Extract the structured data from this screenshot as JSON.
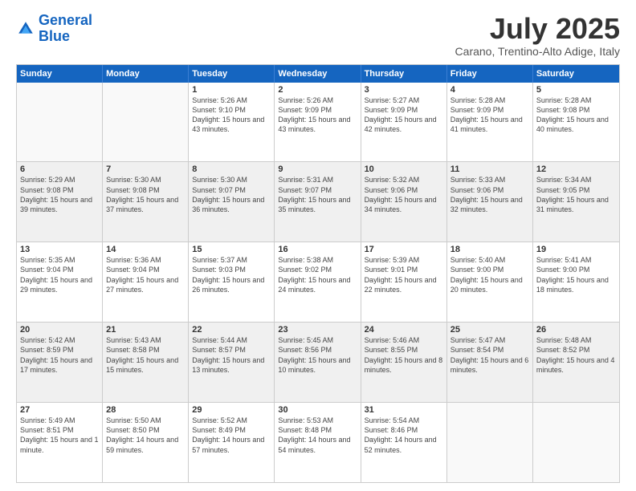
{
  "logo": {
    "line1": "General",
    "line2": "Blue"
  },
  "title": "July 2025",
  "location": "Carano, Trentino-Alto Adige, Italy",
  "days_of_week": [
    "Sunday",
    "Monday",
    "Tuesday",
    "Wednesday",
    "Thursday",
    "Friday",
    "Saturday"
  ],
  "weeks": [
    [
      {
        "day": "",
        "empty": true
      },
      {
        "day": "",
        "empty": true
      },
      {
        "day": "1",
        "sunrise": "5:26 AM",
        "sunset": "9:10 PM",
        "daylight": "15 hours and 43 minutes."
      },
      {
        "day": "2",
        "sunrise": "5:26 AM",
        "sunset": "9:09 PM",
        "daylight": "15 hours and 43 minutes."
      },
      {
        "day": "3",
        "sunrise": "5:27 AM",
        "sunset": "9:09 PM",
        "daylight": "15 hours and 42 minutes."
      },
      {
        "day": "4",
        "sunrise": "5:28 AM",
        "sunset": "9:09 PM",
        "daylight": "15 hours and 41 minutes."
      },
      {
        "day": "5",
        "sunrise": "5:28 AM",
        "sunset": "9:08 PM",
        "daylight": "15 hours and 40 minutes."
      }
    ],
    [
      {
        "day": "6",
        "sunrise": "5:29 AM",
        "sunset": "9:08 PM",
        "daylight": "15 hours and 39 minutes."
      },
      {
        "day": "7",
        "sunrise": "5:30 AM",
        "sunset": "9:08 PM",
        "daylight": "15 hours and 37 minutes."
      },
      {
        "day": "8",
        "sunrise": "5:30 AM",
        "sunset": "9:07 PM",
        "daylight": "15 hours and 36 minutes."
      },
      {
        "day": "9",
        "sunrise": "5:31 AM",
        "sunset": "9:07 PM",
        "daylight": "15 hours and 35 minutes."
      },
      {
        "day": "10",
        "sunrise": "5:32 AM",
        "sunset": "9:06 PM",
        "daylight": "15 hours and 34 minutes."
      },
      {
        "day": "11",
        "sunrise": "5:33 AM",
        "sunset": "9:06 PM",
        "daylight": "15 hours and 32 minutes."
      },
      {
        "day": "12",
        "sunrise": "5:34 AM",
        "sunset": "9:05 PM",
        "daylight": "15 hours and 31 minutes."
      }
    ],
    [
      {
        "day": "13",
        "sunrise": "5:35 AM",
        "sunset": "9:04 PM",
        "daylight": "15 hours and 29 minutes."
      },
      {
        "day": "14",
        "sunrise": "5:36 AM",
        "sunset": "9:04 PM",
        "daylight": "15 hours and 27 minutes."
      },
      {
        "day": "15",
        "sunrise": "5:37 AM",
        "sunset": "9:03 PM",
        "daylight": "15 hours and 26 minutes."
      },
      {
        "day": "16",
        "sunrise": "5:38 AM",
        "sunset": "9:02 PM",
        "daylight": "15 hours and 24 minutes."
      },
      {
        "day": "17",
        "sunrise": "5:39 AM",
        "sunset": "9:01 PM",
        "daylight": "15 hours and 22 minutes."
      },
      {
        "day": "18",
        "sunrise": "5:40 AM",
        "sunset": "9:00 PM",
        "daylight": "15 hours and 20 minutes."
      },
      {
        "day": "19",
        "sunrise": "5:41 AM",
        "sunset": "9:00 PM",
        "daylight": "15 hours and 18 minutes."
      }
    ],
    [
      {
        "day": "20",
        "sunrise": "5:42 AM",
        "sunset": "8:59 PM",
        "daylight": "15 hours and 17 minutes."
      },
      {
        "day": "21",
        "sunrise": "5:43 AM",
        "sunset": "8:58 PM",
        "daylight": "15 hours and 15 minutes."
      },
      {
        "day": "22",
        "sunrise": "5:44 AM",
        "sunset": "8:57 PM",
        "daylight": "15 hours and 13 minutes."
      },
      {
        "day": "23",
        "sunrise": "5:45 AM",
        "sunset": "8:56 PM",
        "daylight": "15 hours and 10 minutes."
      },
      {
        "day": "24",
        "sunrise": "5:46 AM",
        "sunset": "8:55 PM",
        "daylight": "15 hours and 8 minutes."
      },
      {
        "day": "25",
        "sunrise": "5:47 AM",
        "sunset": "8:54 PM",
        "daylight": "15 hours and 6 minutes."
      },
      {
        "day": "26",
        "sunrise": "5:48 AM",
        "sunset": "8:52 PM",
        "daylight": "15 hours and 4 minutes."
      }
    ],
    [
      {
        "day": "27",
        "sunrise": "5:49 AM",
        "sunset": "8:51 PM",
        "daylight": "15 hours and 1 minute."
      },
      {
        "day": "28",
        "sunrise": "5:50 AM",
        "sunset": "8:50 PM",
        "daylight": "14 hours and 59 minutes."
      },
      {
        "day": "29",
        "sunrise": "5:52 AM",
        "sunset": "8:49 PM",
        "daylight": "14 hours and 57 minutes."
      },
      {
        "day": "30",
        "sunrise": "5:53 AM",
        "sunset": "8:48 PM",
        "daylight": "14 hours and 54 minutes."
      },
      {
        "day": "31",
        "sunrise": "5:54 AM",
        "sunset": "8:46 PM",
        "daylight": "14 hours and 52 minutes."
      },
      {
        "day": "",
        "empty": true
      },
      {
        "day": "",
        "empty": true
      }
    ]
  ]
}
